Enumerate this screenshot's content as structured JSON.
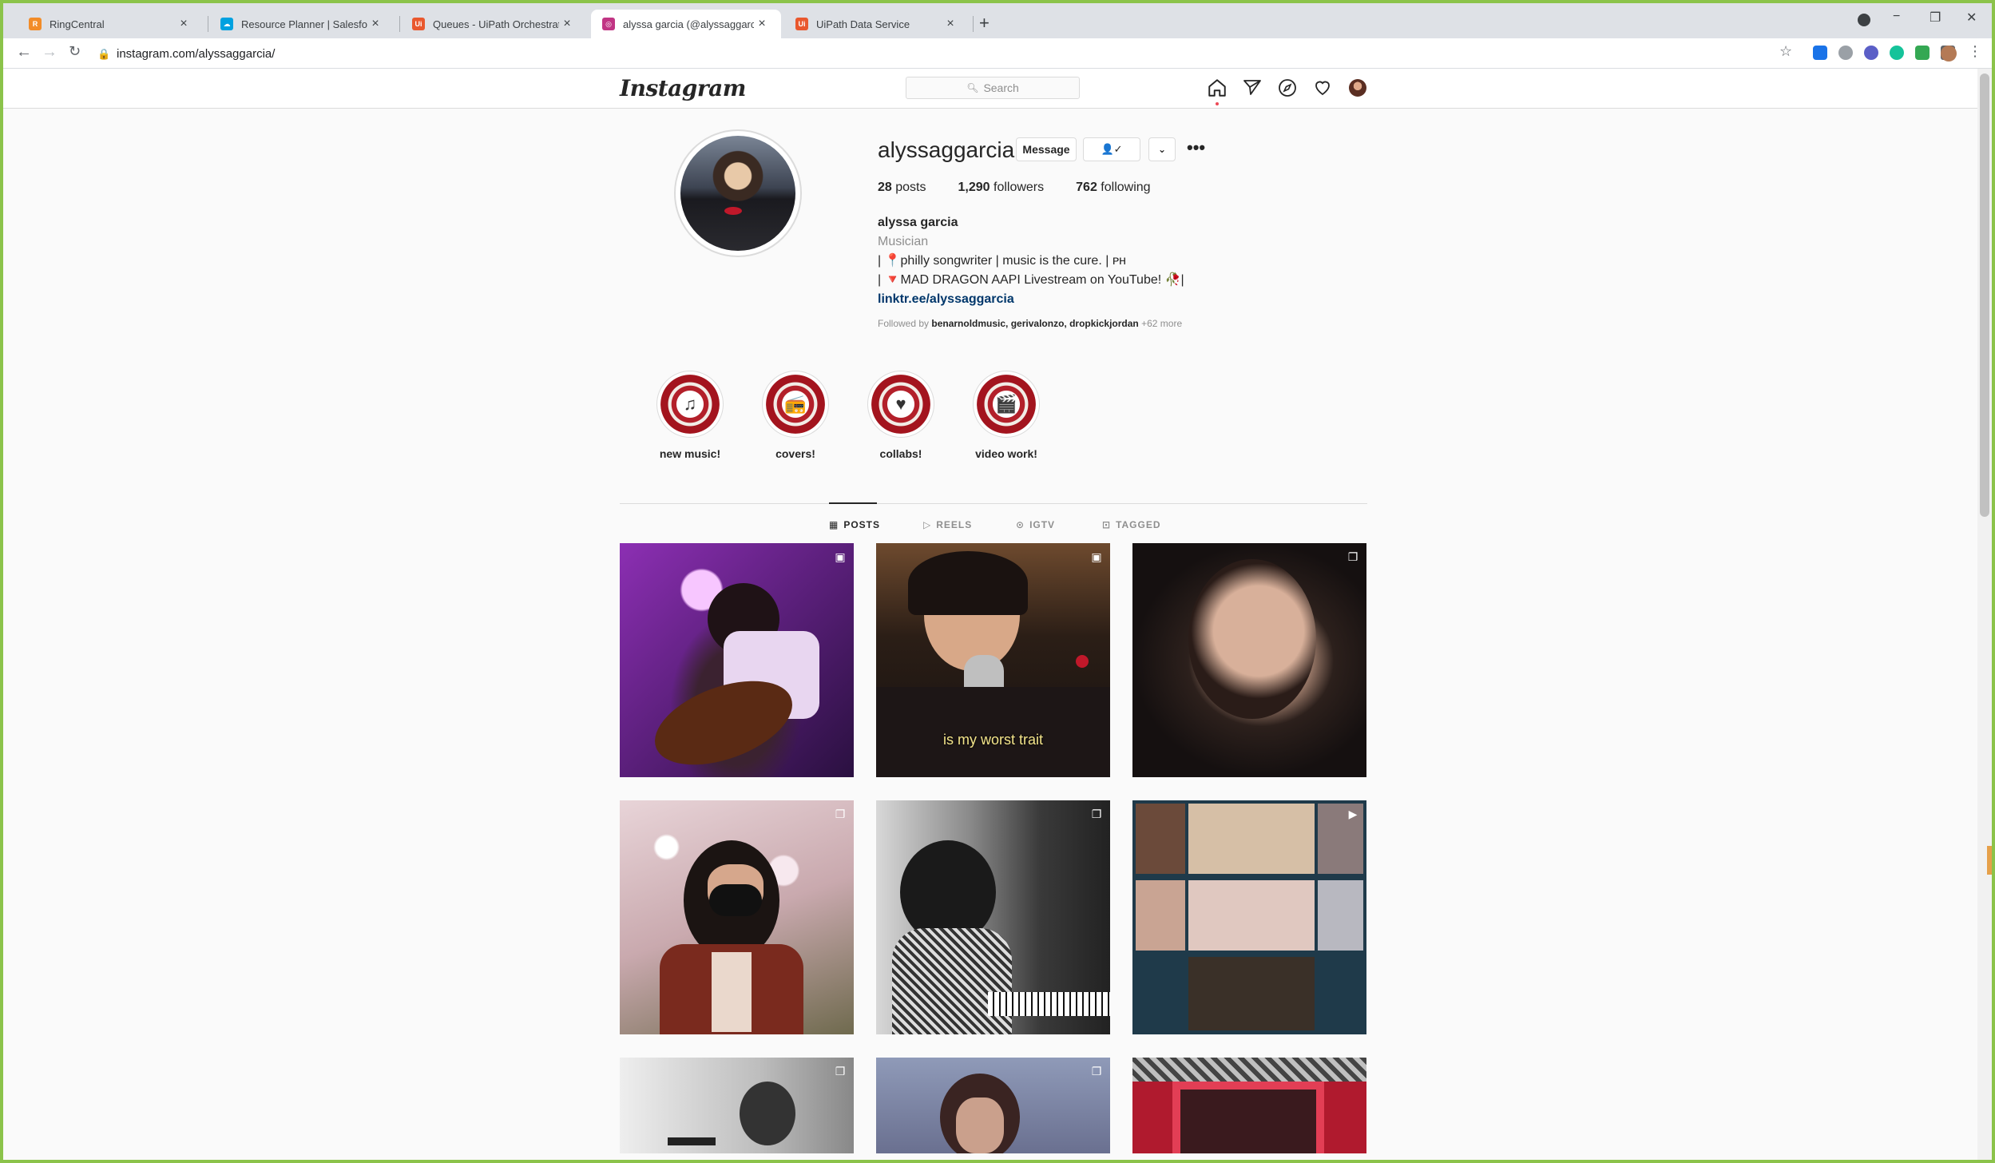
{
  "browser": {
    "tabs": [
      {
        "title": "RingCentral",
        "fav_color": "#f28c28",
        "fav_text": "R"
      },
      {
        "title": "Resource Planner | Salesforce",
        "fav_color": "#00a1e0",
        "fav_text": "☁"
      },
      {
        "title": "Queues - UiPath Orchestrator",
        "fav_color": "#e9582e",
        "fav_text": "Ui"
      },
      {
        "title": "alyssa garcia (@alyssaggarcia) • I",
        "fav_color": "#c13584",
        "fav_text": "◎"
      },
      {
        "title": "UiPath Data Service",
        "fav_color": "#e9582e",
        "fav_text": "Ui"
      }
    ],
    "url": "instagram.com/alyssaggarcia/"
  },
  "instagram": {
    "logo": "Instagram",
    "search_placeholder": "Search",
    "profile": {
      "username": "alyssaggarcia",
      "message_label": "Message",
      "follow_icon": "👤✓",
      "posts_count": "28",
      "posts_label": "posts",
      "followers_count": "1,290",
      "followers_label": "followers",
      "following_count": "762",
      "following_label": "following",
      "full_name": "alyssa garcia",
      "category": "Musician",
      "bio_line1": "| 📍philly songwriter | music is the cure. | ᴘʜ",
      "bio_line2": "| 🔻MAD DRAGON AAPI Livestream on YouTube! 🥀|",
      "link": "linktr.ee/alyssaggarcia",
      "followed_by_prefix": "Followed by",
      "followed_by_names": "benarnoldmusic, gerivalonzo, dropkickjordan",
      "followed_by_more": "+62 more"
    },
    "highlights": [
      {
        "label": "new music!",
        "icon": "♫"
      },
      {
        "label": "covers!",
        "icon": "📻"
      },
      {
        "label": "collabs!",
        "icon": "♥"
      },
      {
        "label": "video work!",
        "icon": "🎬"
      }
    ],
    "profile_tabs": [
      {
        "label": "POSTS",
        "icon": "▦",
        "active": true
      },
      {
        "label": "REELS",
        "icon": "▷",
        "active": false
      },
      {
        "label": "IGTV",
        "icon": "⊙",
        "active": false
      },
      {
        "label": "TAGGED",
        "icon": "⊡",
        "active": false
      }
    ],
    "posts": [
      {
        "caption": ""
      },
      {
        "caption": "is my worst trait"
      },
      {
        "caption": ""
      },
      {
        "caption": ""
      },
      {
        "caption": ""
      },
      {
        "caption": ""
      },
      {
        "caption": ""
      },
      {
        "caption": ""
      },
      {
        "caption": ""
      }
    ]
  }
}
